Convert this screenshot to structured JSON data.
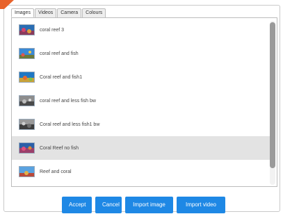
{
  "tabs": [
    {
      "label": "Images",
      "active": true
    },
    {
      "label": "Videos",
      "active": false
    },
    {
      "label": "Camera",
      "active": false
    },
    {
      "label": "Colours",
      "active": false
    }
  ],
  "items": [
    {
      "label": "coral reef 3",
      "thumb": "reef-color",
      "selected": false
    },
    {
      "label": "coral reef and fish",
      "thumb": "reef-color",
      "selected": false
    },
    {
      "label": "Coral reef and fish1",
      "thumb": "reef-color",
      "selected": false
    },
    {
      "label": "coral reef and less fish bw",
      "thumb": "reef-bw",
      "selected": false
    },
    {
      "label": "Coral reef and less fish1 bw",
      "thumb": "reef-bw",
      "selected": false
    },
    {
      "label": "Coral Reef no fish",
      "thumb": "reef-color",
      "selected": true
    },
    {
      "label": "Reef and coral",
      "thumb": "reef-color",
      "selected": false
    }
  ],
  "buttons": {
    "accept": "Accept",
    "cancel": "Cancel",
    "import_image": "Import image",
    "import_video": "Import video"
  },
  "colors": {
    "accent": "#1e88e5",
    "corner_mark": "#e8622a"
  }
}
